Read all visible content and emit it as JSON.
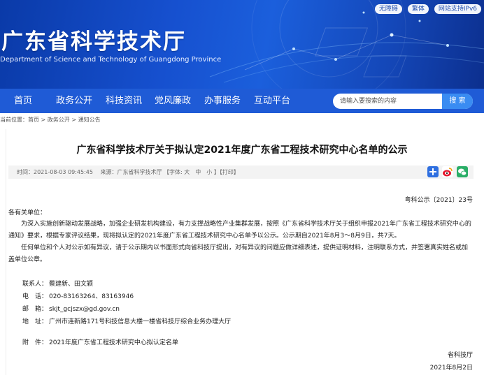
{
  "header": {
    "top_links": [
      "无障碍",
      "繁体",
      "网站支持IPv6"
    ],
    "site_title": "广东省科学技术厅",
    "site_subtitle": "Department of Science and Technology of Guangdong Province"
  },
  "nav": {
    "items": [
      "首页",
      "政务公开",
      "科技资讯",
      "党风廉政",
      "办事服务",
      "互动平台"
    ]
  },
  "search": {
    "placeholder": "请输入要搜索的内容",
    "button_label": "搜 索"
  },
  "breadcrumb": "当前位置：首页 > 政务公开 > 通知公告",
  "article": {
    "title": "广东省科学技术厅关于拟认定2021年度广东省工程技术研究中心名单的公示",
    "meta": "时间：2021-08-03 09:45:45　 来源：广东省科学技术厅 【字体: 大　中　小 】【打印】",
    "doc_number": "粤科公示〔2021〕23号",
    "salutation": "各有关单位：",
    "paragraphs": [
      "为深入实施创新驱动发展战略，加强企业研发机构建设，有力支撑战略性产业集群发展，按照《广东省科学技术厅关于组织申报2021年广东省工程技术研究中心的通知》要求，根据专家评议结果，现将拟认定的2021年度广东省工程技术研究中心名单予以公示。公示期自2021年8月3～8月9日，共7天。",
      "任何单位和个人对公示如有异议，请于公示期内以书面形式向省科技厅提出，对有异议的问题应做详细表述，提供证明材料，注明联系方式，并签署真实姓名或加盖单位公章。"
    ],
    "contacts": [
      {
        "label": "联系人：",
        "value": "蔡建新、田文颖"
      },
      {
        "label": "电　话：",
        "value": "020-83163264、83163946"
      },
      {
        "label": "邮　箱：",
        "value": "skjt_gcjszx@gd.gov.cn"
      },
      {
        "label": "地　址：",
        "value": "广州市连新路171号科技信息大楼一楼省科技厅综合业务办理大厅"
      }
    ],
    "attachment_label": "附　件：",
    "attachment_value": "2021年度广东省工程技术研究中心拟认定名单",
    "signature": "省科技厅",
    "date": "2021年8月2日"
  },
  "colors": {
    "nav_bg": "#1f5bd6",
    "search_button": "#3a8cf2",
    "share_plus": "#2f6fe0",
    "share_weibo": "#e6162d",
    "share_wechat": "#2aae67"
  }
}
